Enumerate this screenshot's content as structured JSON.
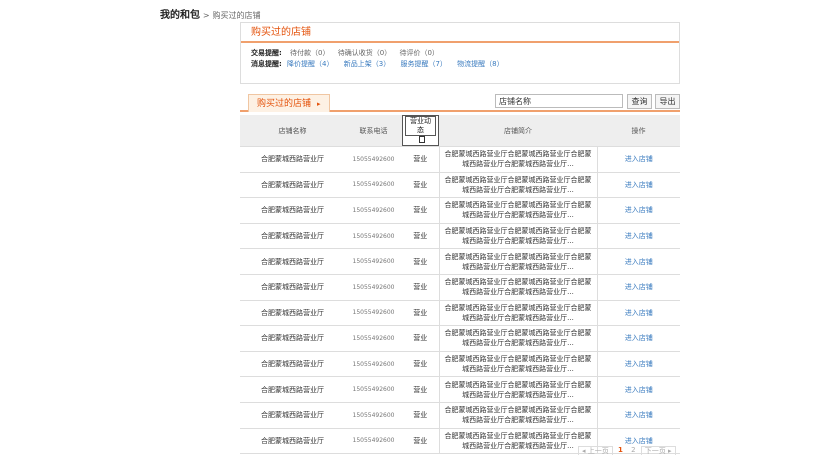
{
  "breadcrumb": {
    "home": "我的和包",
    "sep": ">",
    "current": "购买过的店铺"
  },
  "panel": {
    "title": "购买过的店铺",
    "trade_label": "交易提醒:",
    "trade_items": [
      "待付款（0）",
      "待确认收货（0）",
      "待评价（0）"
    ],
    "msg_label": "消息提醒:",
    "msg_items": [
      "降价提醒（4）",
      "新品上架（3）",
      "服务提醒（7）",
      "物流提醒（8）"
    ]
  },
  "toolbar": {
    "tab_label": "购买过的店铺",
    "tab_arrow": "▸",
    "search_value": "店铺名称",
    "query_label": "查询",
    "export_label": "导出"
  },
  "table": {
    "headers": {
      "name": "店铺名称",
      "phone": "联系电话",
      "status": "营业动态",
      "desc": "店铺简介",
      "op": "操作"
    },
    "rows": [
      {
        "name": "合肥蒙城西路营业厅",
        "phone": "15055492600",
        "status": "营业",
        "desc": "合肥蒙城西路营业厅合肥蒙城西路营业厅合肥蒙城西路营业厅合肥蒙城西路营业厅...",
        "op": "进入店铺"
      },
      {
        "name": "合肥蒙城西路营业厅",
        "phone": "15055492600",
        "status": "营业",
        "desc": "合肥蒙城西路营业厅合肥蒙城西路营业厅合肥蒙城西路营业厅合肥蒙城西路营业厅...",
        "op": "进入店铺"
      },
      {
        "name": "合肥蒙城西路营业厅",
        "phone": "15055492600",
        "status": "营业",
        "desc": "合肥蒙城西路营业厅合肥蒙城西路营业厅合肥蒙城西路营业厅合肥蒙城西路营业厅...",
        "op": "进入店铺"
      },
      {
        "name": "合肥蒙城西路营业厅",
        "phone": "15055492600",
        "status": "营业",
        "desc": "合肥蒙城西路营业厅合肥蒙城西路营业厅合肥蒙城西路营业厅合肥蒙城西路营业厅...",
        "op": "进入店铺"
      },
      {
        "name": "合肥蒙城西路营业厅",
        "phone": "15055492600",
        "status": "营业",
        "desc": "合肥蒙城西路营业厅合肥蒙城西路营业厅合肥蒙城西路营业厅合肥蒙城西路营业厅...",
        "op": "进入店铺"
      },
      {
        "name": "合肥蒙城西路营业厅",
        "phone": "15055492600",
        "status": "营业",
        "desc": "合肥蒙城西路营业厅合肥蒙城西路营业厅合肥蒙城西路营业厅合肥蒙城西路营业厅...",
        "op": "进入店铺"
      },
      {
        "name": "合肥蒙城西路营业厅",
        "phone": "15055492600",
        "status": "营业",
        "desc": "合肥蒙城西路营业厅合肥蒙城西路营业厅合肥蒙城西路营业厅合肥蒙城西路营业厅...",
        "op": "进入店铺"
      },
      {
        "name": "合肥蒙城西路营业厅",
        "phone": "15055492600",
        "status": "营业",
        "desc": "合肥蒙城西路营业厅合肥蒙城西路营业厅合肥蒙城西路营业厅合肥蒙城西路营业厅...",
        "op": "进入店铺"
      },
      {
        "name": "合肥蒙城西路营业厅",
        "phone": "15055492600",
        "status": "营业",
        "desc": "合肥蒙城西路营业厅合肥蒙城西路营业厅合肥蒙城西路营业厅合肥蒙城西路营业厅...",
        "op": "进入店铺"
      },
      {
        "name": "合肥蒙城西路营业厅",
        "phone": "15055492600",
        "status": "营业",
        "desc": "合肥蒙城西路营业厅合肥蒙城西路营业厅合肥蒙城西路营业厅合肥蒙城西路营业厅...",
        "op": "进入店铺"
      },
      {
        "name": "合肥蒙城西路营业厅",
        "phone": "15055492600",
        "status": "营业",
        "desc": "合肥蒙城西路营业厅合肥蒙城西路营业厅合肥蒙城西路营业厅合肥蒙城西路营业厅...",
        "op": "进入店铺"
      },
      {
        "name": "合肥蒙城西路营业厅",
        "phone": "15055492600",
        "status": "营业",
        "desc": "合肥蒙城西路营业厅合肥蒙城西路营业厅合肥蒙城西路营业厅合肥蒙城西路营业厅...",
        "op": "进入店铺"
      }
    ]
  },
  "pager": {
    "prev": "◂ 上一页",
    "current": "1",
    "next_num": "2",
    "next": "下一页 ▸"
  },
  "colors": {
    "accent": "#e4520b",
    "link": "#3a7bbf",
    "tab_bg": "#fdf1e4"
  }
}
